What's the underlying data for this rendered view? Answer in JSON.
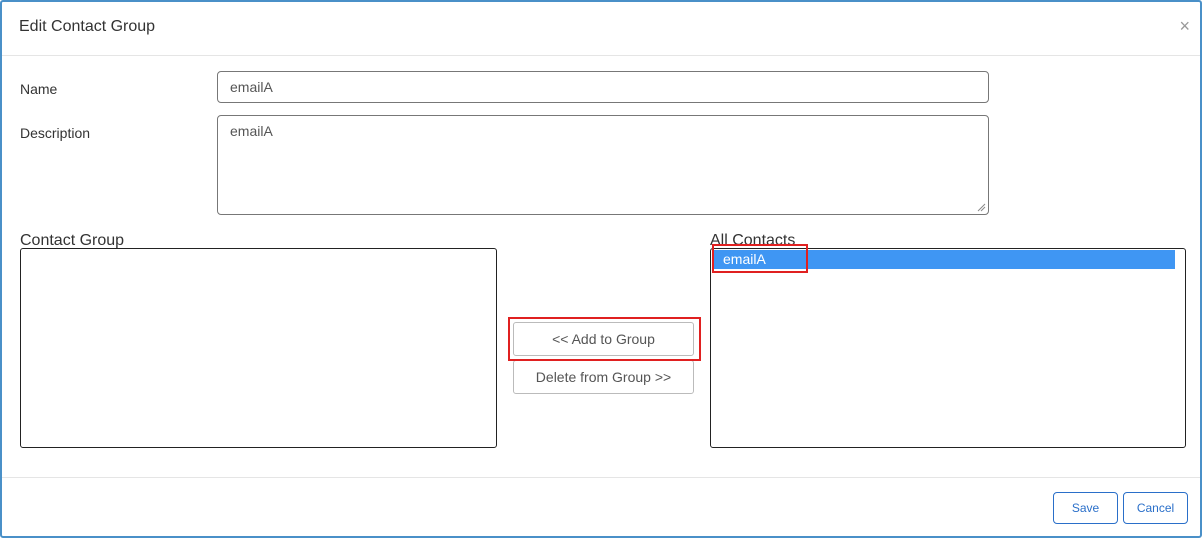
{
  "dialog": {
    "title": "Edit Contact Group",
    "close_symbol": "×"
  },
  "form": {
    "name_label": "Name",
    "name_value": "emailA",
    "description_label": "Description",
    "description_value": "emailA"
  },
  "contact_group": {
    "title": "Contact Group",
    "items": []
  },
  "all_contacts": {
    "title": "All Contacts",
    "items": [
      {
        "label": "emailA",
        "selected": true
      }
    ]
  },
  "transfer": {
    "add_label": "<< Add to Group",
    "delete_label": "Delete from Group >>"
  },
  "footer": {
    "save_label": "Save",
    "cancel_label": "Cancel"
  },
  "colors": {
    "accent": "#2a6fc9",
    "selection": "#3f96f3",
    "annotation": "#e02020",
    "dialog_border": "#4a90c8"
  },
  "icons": {
    "close": "close-icon"
  }
}
